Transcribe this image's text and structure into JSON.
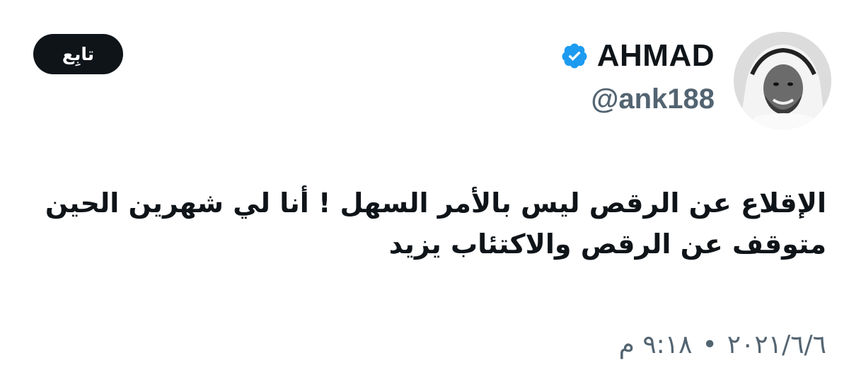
{
  "tweet": {
    "author": {
      "display_name": "AHMAD",
      "handle": "@ank188",
      "verified": true,
      "avatar_icon": "user-avatar",
      "verified_icon": "verified-badge-icon",
      "verified_color": "#1d9bf0"
    },
    "follow_label": "تابِع",
    "text": "الإقلاع عن الرقص ليس بالأمر السهل ! أنا لي شهرين الحين متوقف عن الرقص والاكتئاب يزيد",
    "date": "٢٠٢١/٦/٦",
    "separator": "•",
    "time": "٩:١٨ م"
  },
  "colors": {
    "text_primary": "#0f1419",
    "text_secondary": "#536471",
    "button_bg": "#0f1419",
    "button_text": "#ffffff"
  }
}
